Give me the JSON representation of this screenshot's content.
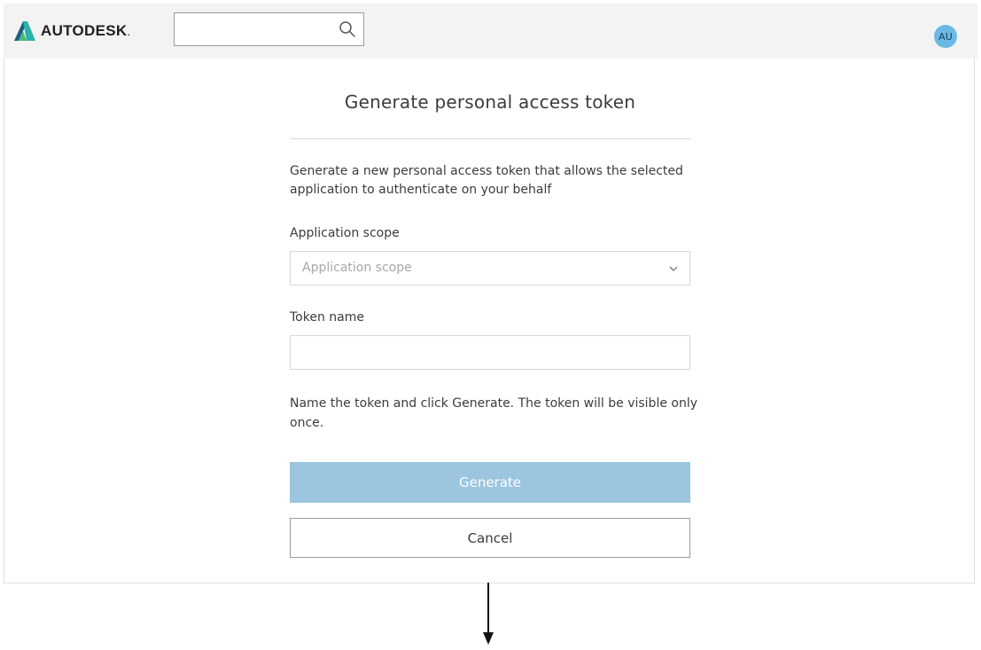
{
  "header": {
    "brand": "AUTODESK",
    "brand_mark": ".",
    "search": {
      "value": "",
      "placeholder": ""
    },
    "avatar_initials": "AU"
  },
  "form": {
    "title": "Generate personal access token",
    "description": "Generate a new personal access token that allows the selected application to authenticate on your behalf",
    "scope_label": "Application scope",
    "scope_placeholder": "Application scope",
    "token_label": "Token name",
    "token_value": "",
    "hint": "Name the token and click Generate. The token will be visible only once.",
    "generate_label": "Generate",
    "cancel_label": "Cancel"
  },
  "colors": {
    "accent": "#9cc5df",
    "avatar": "#6ab8e4",
    "topbar": "#f3f3f3"
  }
}
